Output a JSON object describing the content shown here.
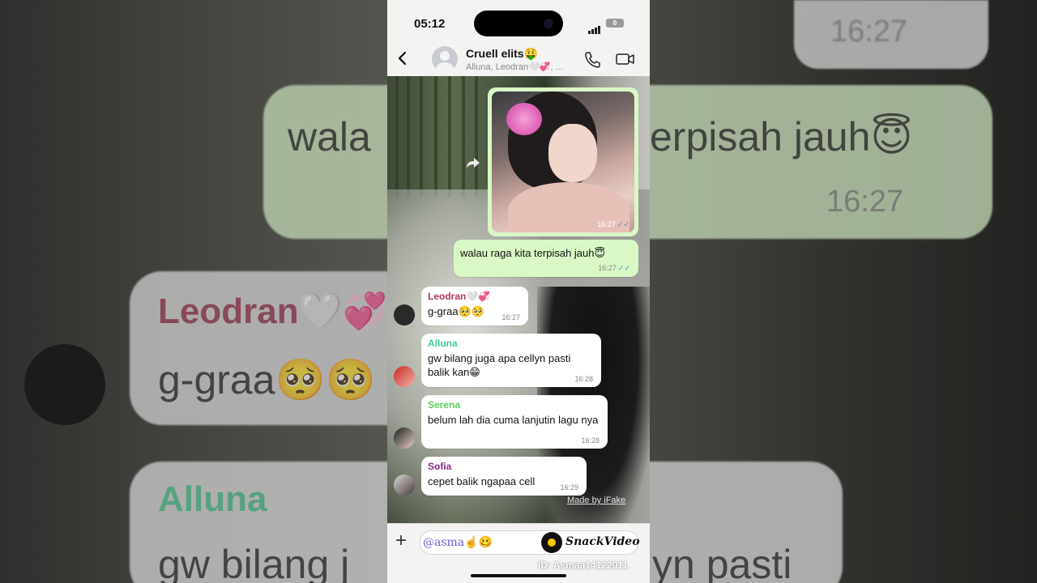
{
  "status_bar": {
    "time": "05:12",
    "battery": "0"
  },
  "header": {
    "group_name": "Cruell elits🤑",
    "members": "Alluna, Leodran🤍💞, ..."
  },
  "image_message": {
    "time": "16:27",
    "ticks": "✓✓"
  },
  "messages": [
    {
      "direction": "out",
      "sender": "",
      "text": "walau raga kita terpisah jauh😇",
      "time": "16:27",
      "ticks": "✓✓"
    },
    {
      "direction": "in",
      "sender": "Leodran🤍💞",
      "sender_color": "#b03a5b",
      "text": "g-graa🥺🥺",
      "time": "16:27"
    },
    {
      "direction": "in",
      "sender": "Alluna",
      "sender_color": "#3ec7a0",
      "text": "gw bilang juga apa cellyn pasti balik kan😁",
      "time": "16:28"
    },
    {
      "direction": "in",
      "sender": "Serena",
      "sender_color": "#5bd05b",
      "text": "belum lah dia cuma lanjutin lagu nya",
      "time": "16:28"
    },
    {
      "direction": "in",
      "sender": "Sofia",
      "sender_color": "#8e2d8a",
      "text": "cepet balik ngapaa cell",
      "time": "16:29"
    }
  ],
  "watermark": "Made by iFake",
  "composer": {
    "value": "@asma☝🥴"
  },
  "overlay": {
    "brand": "SnackVideo",
    "user_id": "ID: Asmaa14122011"
  },
  "background_zoom": {
    "top_time": "16:27",
    "text1": "wala",
    "text2": "erpisah jauh😇",
    "time2": "16:27",
    "sender": "Leodran🤍💞",
    "text3": "g-graa🥺🥺",
    "sender2": "Alluna",
    "text4": "gw bilang j",
    "text5": "yn pasti"
  }
}
